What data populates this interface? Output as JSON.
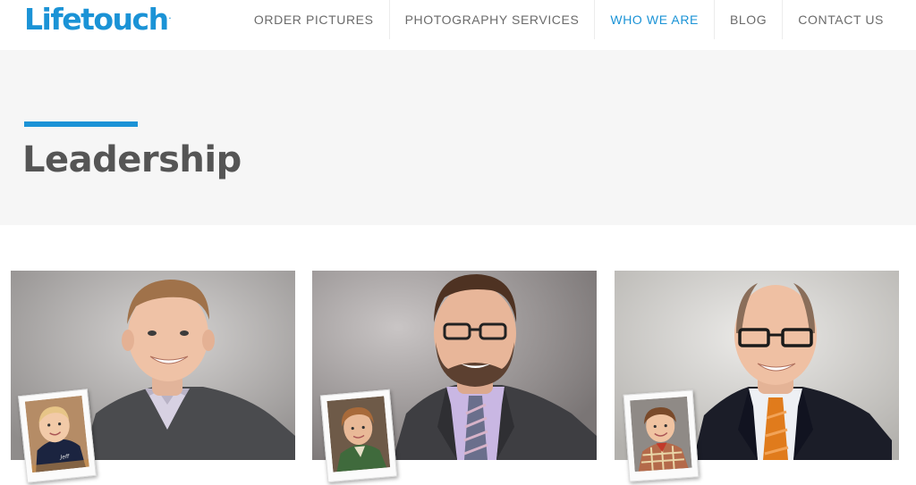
{
  "brand": {
    "name": "Lifetouch",
    "mark": "."
  },
  "nav": {
    "items": [
      {
        "label": "ORDER PICTURES",
        "active": false
      },
      {
        "label": "PHOTOGRAPHY SERVICES",
        "active": false
      },
      {
        "label": "WHO WE ARE",
        "active": true
      },
      {
        "label": "BLOG",
        "active": false
      },
      {
        "label": "CONTACT US",
        "active": false
      }
    ]
  },
  "hero": {
    "title": "Leadership"
  },
  "colors": {
    "accent": "#1b93d6",
    "hero_bg": "#f6f6f6",
    "title_text": "#555555",
    "nav_text": "#6b6b6b"
  },
  "leaders": [
    {
      "photo": "leader-1-adult-portrait",
      "childhood_photo": "leader-1-childhood-photo"
    },
    {
      "photo": "leader-2-adult-portrait",
      "childhood_photo": "leader-2-childhood-photo"
    },
    {
      "photo": "leader-3-adult-portrait",
      "childhood_photo": "leader-3-childhood-photo"
    }
  ]
}
